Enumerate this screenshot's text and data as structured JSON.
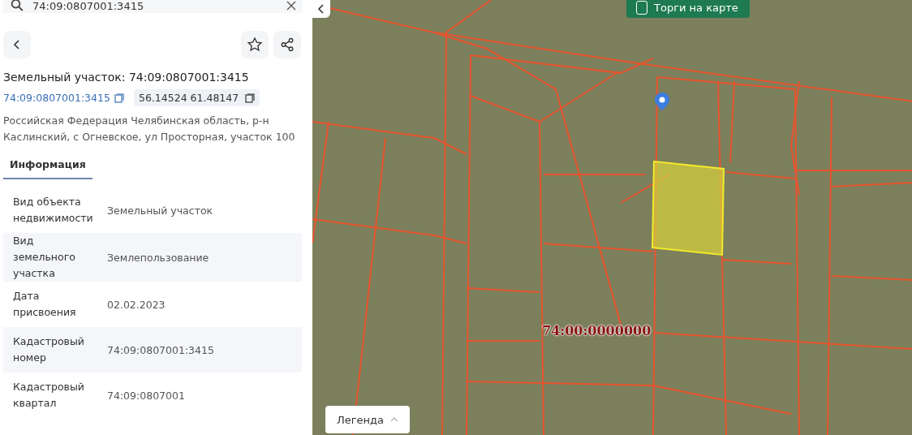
{
  "search": {
    "value": "74:09:0807001:3415"
  },
  "title": "Земельный участок: 74:09:0807001:3415",
  "cadastral_link": "74:09:0807001:3415",
  "coordinates": "56.14524 61.48147",
  "address": "Российская Федерация Челябинская область, р-н Каслинский, с Огневское, ул Просторная, участок 100",
  "tabs": [
    {
      "label": "Информация",
      "selected": true
    }
  ],
  "rows": [
    {
      "label": "Вид объекта недвижимости",
      "value": "Земельный участок"
    },
    {
      "label": "Вид земельного участка",
      "value": "Землепользование"
    },
    {
      "label": "Дата присвоения",
      "value": "02.02.2023"
    },
    {
      "label": "Кадастровый номер",
      "value": "74:09:0807001:3415"
    },
    {
      "label": "Кадастровый квартал",
      "value": "74:09:0807001"
    }
  ],
  "map": {
    "toggle": {
      "label": "Торги на карте",
      "checked": false
    },
    "quarter_label": "74:00:0000000",
    "legend": {
      "label": "Легенда",
      "expanded": false
    }
  }
}
